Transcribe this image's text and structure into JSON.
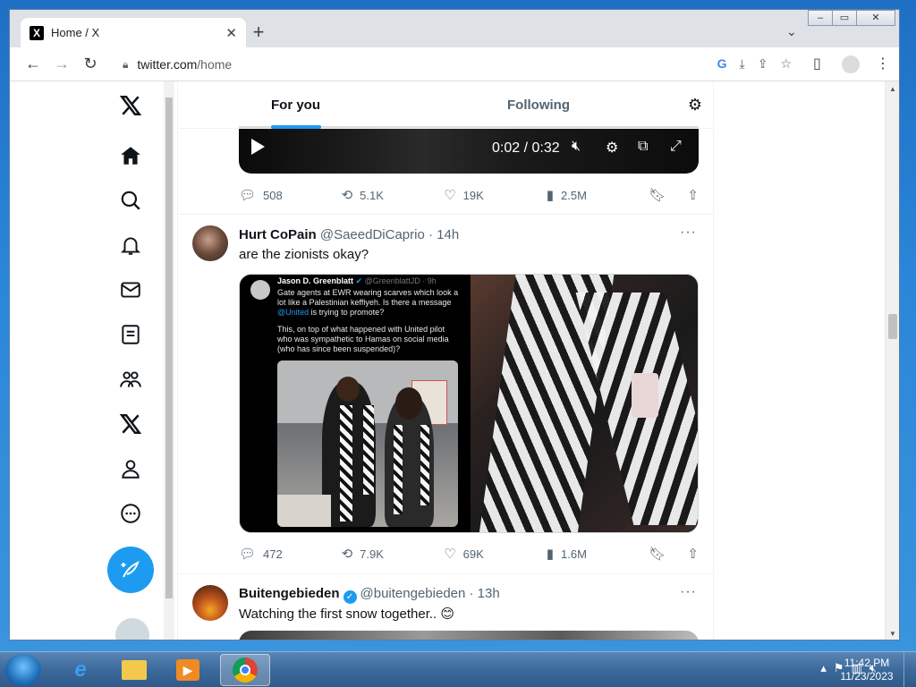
{
  "browser": {
    "tab_title": "Home / X",
    "tab_favicon": "X",
    "tab_close": "✕",
    "new_tab": "+",
    "url_domain": "twitter.com",
    "url_path": "/home",
    "window_controls": {
      "minimize": "–",
      "maximize": "▭",
      "close": "✕"
    }
  },
  "timeline": {
    "tabs": [
      "For you",
      "Following"
    ]
  },
  "video": {
    "time": "0:02 / 0:32"
  },
  "tweet0_actions": {
    "replies": "508",
    "reposts": "5.1K",
    "likes": "19K",
    "views": "2.5M"
  },
  "tweet1": {
    "name": "Hurt CoPain",
    "handle": "@SaeedDiCaprio",
    "time": "· 14h",
    "text": "are the zionists okay?",
    "quote": {
      "name": "Jason D. Greenblatt",
      "handle": "@GreenblattJD · 9h",
      "text_before": "Gate agents at EWR wearing scarves which look a lot like a Palestinian keffiyeh. Is there a message ",
      "mention": "@United",
      "text_after": " is trying to promote?",
      "text2": "This, on top of what happened with United pilot who was sympathetic to Hamas on social media (who has since been suspended)?"
    },
    "actions": {
      "replies": "472",
      "reposts": "7.9K",
      "likes": "69K",
      "views": "1.6M"
    }
  },
  "tweet2": {
    "name": "Buitengebieden",
    "handle": "@buitengebieden",
    "time": "· 13h",
    "text": "Watching the first snow together.. 😊"
  },
  "taskbar": {
    "time": "11:42 PM",
    "date": "11/23/2023"
  },
  "colors": {
    "accent": "#1d9bf0",
    "text_primary": "#0f1419",
    "text_secondary": "#536471"
  }
}
